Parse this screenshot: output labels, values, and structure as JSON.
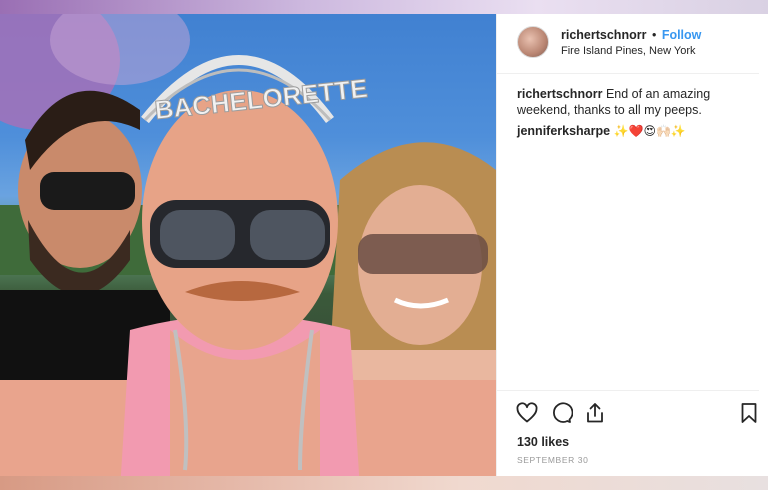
{
  "post": {
    "username": "richertschnorr",
    "separator": "•",
    "follow_label": "Follow",
    "location": "Fire Island Pines, New York",
    "caption_user": "richertschnorr",
    "caption_text": "End of an amazing weekend, thanks to all my peeps.",
    "comment_user": "jenniferksharpe",
    "comment_text": "✨❤️😍🙌🏻✨",
    "likes": "130 likes",
    "date": "SEPTEMBER 30",
    "tiara_text": "BACHELORETTE"
  },
  "icons": [
    "heart-icon",
    "comment-icon",
    "share-icon",
    "bookmark-icon"
  ],
  "colors": {
    "follow": "#3897f0",
    "date": "#999999",
    "border": "#efefef"
  }
}
